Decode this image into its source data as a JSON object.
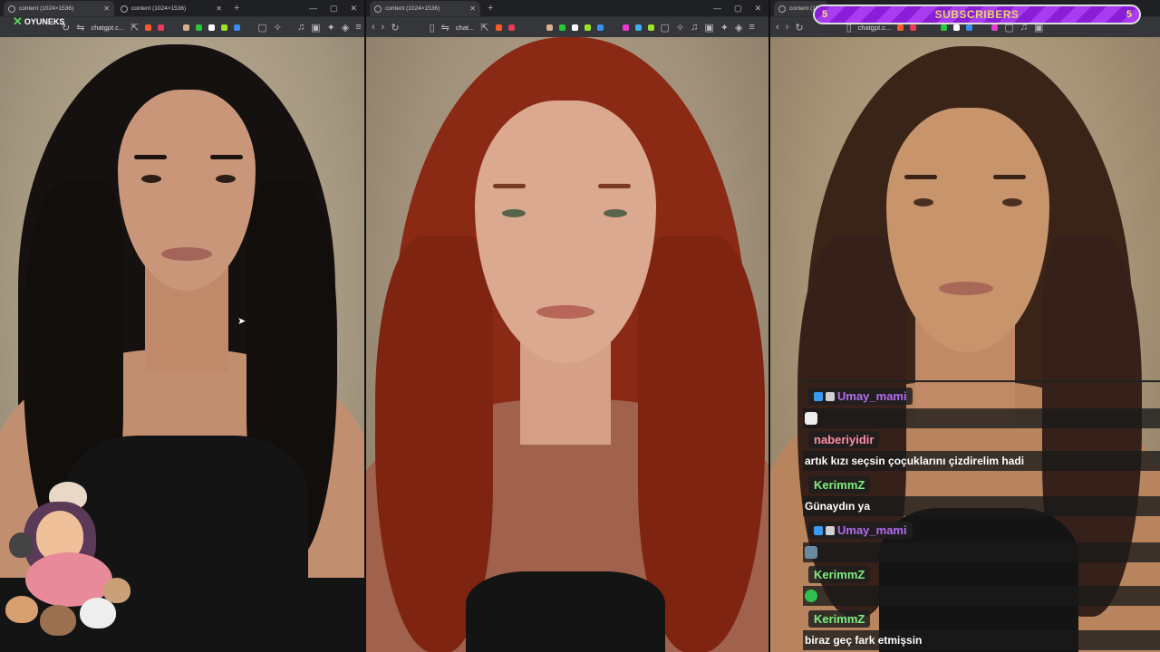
{
  "windows": [
    {
      "tabs": [
        {
          "title": "content (1024×1536)",
          "close": "✕"
        },
        {
          "title": "content (1024×1536)",
          "close": "✕"
        }
      ],
      "new_tab": "+",
      "address": "chatgpt.c..."
    },
    {
      "tabs": [
        {
          "title": "content (1024×1536)",
          "close": "✕"
        }
      ],
      "new_tab": "+",
      "address": "chat..."
    },
    {
      "tabs": [
        {
          "title": "content (10",
          "close": "✕"
        }
      ],
      "address": "chatgpt.c..."
    }
  ],
  "window_controls": {
    "minimize": "—",
    "maximize": "▢",
    "close": "✕"
  },
  "nav": {
    "back": "‹",
    "forward": "›",
    "reload": "↻"
  },
  "logo": {
    "text": "OYUNEKS"
  },
  "subscribers": {
    "label": "SUBSCRIBERS",
    "count_left": "5",
    "count_right": "5"
  },
  "chat": {
    "messages": [
      {
        "name": "Umay_mami",
        "name_color": "#b36cf2",
        "body": "",
        "has_badges": true,
        "emoji": "duck"
      },
      {
        "name": "naberiyidir",
        "name_color": "#ff8fa8",
        "body": "artık kızı seçsin çoçuklarını çizdirelim hadi",
        "has_badges": false
      },
      {
        "name": "KerimmZ",
        "name_color": "#7cf07c",
        "body": "Günaydın ya",
        "has_badges": false
      },
      {
        "name": "Umay_mami",
        "name_color": "#b36cf2",
        "body": "",
        "has_badges": true,
        "emoji": "robot"
      },
      {
        "name": "KerimmZ",
        "name_color": "#7cf07c",
        "body": "",
        "has_badges": false,
        "emoji": "green-face"
      },
      {
        "name": "KerimmZ",
        "name_color": "#7cf07c",
        "body": "biraz geç fark etmişsin",
        "has_badges": false
      }
    ]
  },
  "colors": {
    "subscriber_banner": "#9b2ee6",
    "subscriber_text": "#f3e36a",
    "chat_bg": "#191919",
    "hair_black": "#151110",
    "hair_red": "#8a2a14",
    "hair_brown": "#3a2418"
  }
}
